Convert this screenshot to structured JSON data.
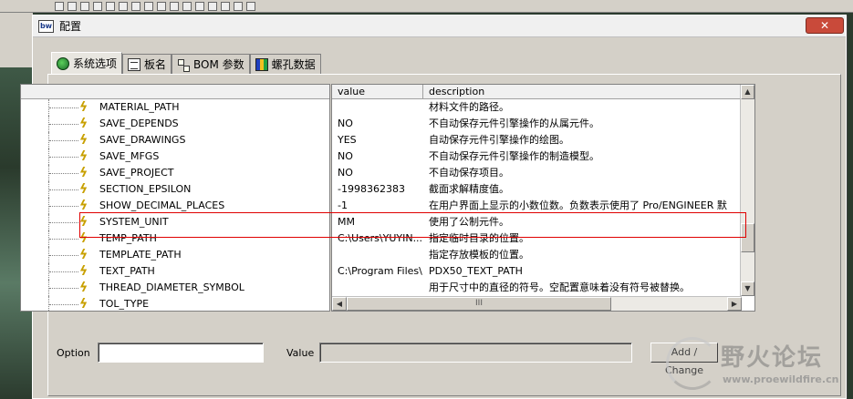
{
  "dialog": {
    "title": "配置",
    "icon_label": "bw",
    "close_glyph": "✕"
  },
  "tabs": [
    {
      "label": "系统选项",
      "icon": "globe-icon"
    },
    {
      "label": "板名",
      "icon": "board-icon"
    },
    {
      "label": "BOM 参数",
      "icon": "tree-icon"
    },
    {
      "label": "螺孔数据",
      "icon": "hole-icon"
    }
  ],
  "tree": {
    "items": [
      "MATERIAL_PATH",
      "SAVE_DEPENDS",
      "SAVE_DRAWINGS",
      "SAVE_MFGS",
      "SAVE_PROJECT",
      "SECTION_EPSILON",
      "SHOW_DECIMAL_PLACES",
      "SYSTEM_UNIT",
      "TEMP_PATH",
      "TEMPLATE_PATH",
      "TEXT_PATH",
      "THREAD_DIAMETER_SYMBOL",
      "TOL_TYPE"
    ]
  },
  "list": {
    "columns": [
      "value",
      "description"
    ],
    "rows": [
      {
        "value": "",
        "description": "材料文件的路径。"
      },
      {
        "value": "NO",
        "description": "不自动保存元件引擎操作的从属元件。"
      },
      {
        "value": "YES",
        "description": "自动保存元件引擎操作的绘图。"
      },
      {
        "value": "NO",
        "description": "不自动保存元件引擎操作的制造模型。"
      },
      {
        "value": "NO",
        "description": "不自动保存项目。"
      },
      {
        "value": "-1998362383",
        "description": "截面求解精度值。"
      },
      {
        "value": "-1",
        "description": "在用户界面上显示的小数位数。负数表示使用了 Pro/ENGINEER 默"
      },
      {
        "value": "MM",
        "description": "使用了公制元件。"
      },
      {
        "value": "C:\\Users\\YUYIN...",
        "description": "指定临时目录的位置。"
      },
      {
        "value": "",
        "description": "指定存放模板的位置。"
      },
      {
        "value": "C:\\Program Files\\...",
        "description": "PDX50_TEXT_PATH"
      },
      {
        "value": "",
        "description": "用于尺寸中的直径的符号。空配置意味着没有符号被替换。"
      }
    ],
    "scroll_grip": "III"
  },
  "bottom": {
    "option_label": "Option",
    "option_value": "",
    "value_label": "Value",
    "value_value": "",
    "add_change_label": "Add / Change"
  },
  "watermark": {
    "text": "野火论坛",
    "url": "www.proewildfire.cn"
  }
}
